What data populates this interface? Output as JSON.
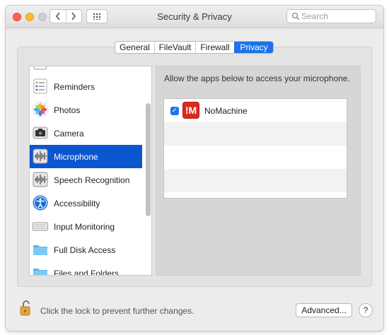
{
  "window": {
    "title": "Security & Privacy",
    "nav_back": "‹",
    "nav_forward": "›",
    "search_placeholder": "Search"
  },
  "tabs": [
    {
      "label": "General",
      "active": false
    },
    {
      "label": "FileVault",
      "active": false
    },
    {
      "label": "Firewall",
      "active": false
    },
    {
      "label": "Privacy",
      "active": true
    }
  ],
  "sidebar": {
    "selected": "Microphone",
    "items": [
      {
        "label": "Reminders",
        "icon": "reminders-icon"
      },
      {
        "label": "Photos",
        "icon": "photos-icon"
      },
      {
        "label": "Camera",
        "icon": "camera-icon"
      },
      {
        "label": "Microphone",
        "icon": "microphone-icon"
      },
      {
        "label": "Speech Recognition",
        "icon": "speech-recognition-icon"
      },
      {
        "label": "Accessibility",
        "icon": "accessibility-icon"
      },
      {
        "label": "Input Monitoring",
        "icon": "keyboard-icon"
      },
      {
        "label": "Full Disk Access",
        "icon": "folder-icon"
      },
      {
        "label": "Files and Folders",
        "icon": "folder-icon"
      }
    ]
  },
  "main": {
    "description": "Allow the apps below to access your microphone.",
    "apps": [
      {
        "name": "NoMachine",
        "checked": true,
        "icon": "nomachine-icon",
        "icon_text": "!M"
      }
    ],
    "checkmark": "✓"
  },
  "footer": {
    "lock_message": "Click the lock to prevent further changes.",
    "advanced_label": "Advanced...",
    "help_label": "?"
  },
  "colors": {
    "accent": "#1a73e8",
    "selection": "#0b57d0",
    "nomachine": "#d82b20"
  }
}
